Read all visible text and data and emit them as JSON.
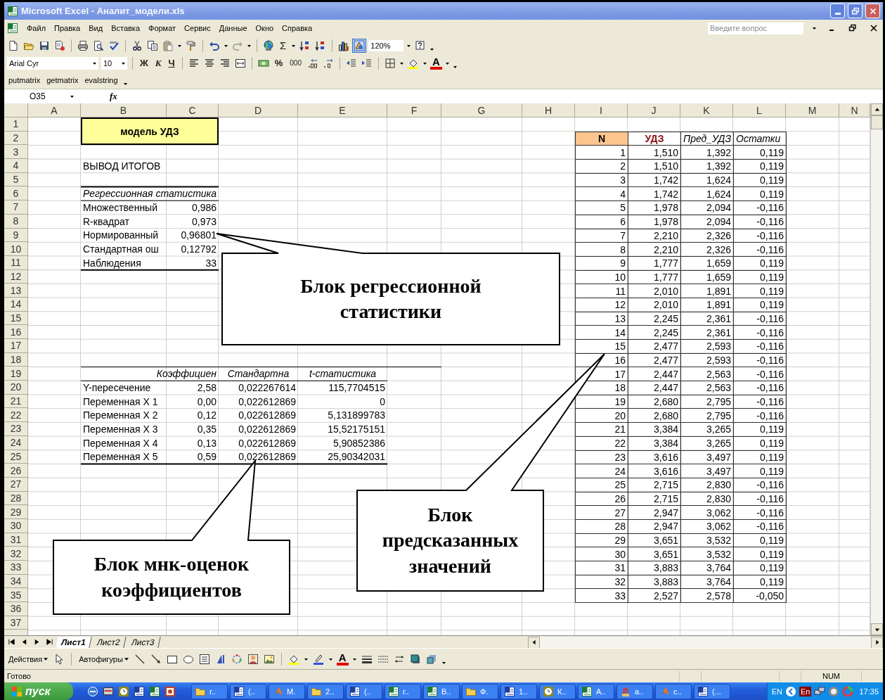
{
  "window": {
    "title": "Microsoft Excel - Аналит_модели.xls"
  },
  "menu": {
    "items": [
      "Файл",
      "Правка",
      "Вид",
      "Вставка",
      "Формат",
      "Сервис",
      "Данные",
      "Окно",
      "Справка"
    ],
    "help_placeholder": "Введите вопрос"
  },
  "standard_toolbar": {
    "sum_label": "Σ",
    "zoom": "120%"
  },
  "formatting_toolbar": {
    "font": "Arial Cyr",
    "size": "10",
    "bold_label": "Ж",
    "italic_label": "К",
    "underline_label": "Ч",
    "percent_label": "%",
    "thousands_label": "000",
    "font_color_label": "A"
  },
  "custom_toolbar": {
    "buttons": [
      "putmatrix",
      "getmatrix",
      "evalstring"
    ]
  },
  "formula_bar": {
    "name_box": "O35",
    "fx_label": "fx"
  },
  "sheet": {
    "columns": [
      "A",
      "B",
      "C",
      "D",
      "E",
      "F",
      "G",
      "H",
      "I",
      "J",
      "K",
      "L",
      "M",
      "N"
    ],
    "rows": [
      "1",
      "2",
      "3",
      "4",
      "5",
      "6",
      "7",
      "8",
      "9",
      "10",
      "11",
      "12",
      "13",
      "14",
      "15",
      "16",
      "17",
      "18",
      "19",
      "20",
      "21",
      "22",
      "23",
      "24",
      "25",
      "26",
      "27",
      "28",
      "29",
      "30",
      "31",
      "32",
      "33",
      "34",
      "35",
      "36",
      "37"
    ],
    "title_cell": "модель УДЗ",
    "summary_label": "ВЫВОД ИТОГОВ",
    "regression_stats": {
      "title": "Регрессионная статистика",
      "rows": [
        {
          "label": "Множественный",
          "value": "0,986"
        },
        {
          "label": "R-квадрат",
          "value": "0,973"
        },
        {
          "label": "Нормированный",
          "value": "0,96801"
        },
        {
          "label": "Стандартная ош",
          "value": "0,12792"
        },
        {
          "label": "Наблюдения",
          "value": "33"
        }
      ]
    },
    "coefficients": {
      "headers": [
        "Коэффициен",
        "Стандартна",
        "t-статистика"
      ],
      "rows": [
        {
          "label": "Y-пересечение",
          "values": [
            "2,58",
            "0,022267614",
            "115,7704515"
          ]
        },
        {
          "label": "Переменная X 1",
          "values": [
            "0,00",
            "0,022612869",
            "0"
          ]
        },
        {
          "label": "Переменная X 2",
          "values": [
            "0,12",
            "0,022612869",
            "5,131899783"
          ]
        },
        {
          "label": "Переменная X 3",
          "values": [
            "0,35",
            "0,022612869",
            "15,52175151"
          ]
        },
        {
          "label": "Переменная X 4",
          "values": [
            "0,13",
            "0,022612869",
            "5,90852386"
          ]
        },
        {
          "label": "Переменная X 5",
          "values": [
            "0,59",
            "0,022612869",
            "25,90342031"
          ]
        }
      ]
    },
    "predictions": {
      "headers": [
        "N",
        "УДЗ",
        "Пред_УДЗ",
        "Остатки"
      ],
      "rows": [
        [
          "1",
          "1,510",
          "1,392",
          "0,119"
        ],
        [
          "2",
          "1,510",
          "1,392",
          "0,119"
        ],
        [
          "3",
          "1,742",
          "1,624",
          "0,119"
        ],
        [
          "4",
          "1,742",
          "1,624",
          "0,119"
        ],
        [
          "5",
          "1,978",
          "2,094",
          "-0,116"
        ],
        [
          "6",
          "1,978",
          "2,094",
          "-0,116"
        ],
        [
          "7",
          "2,210",
          "2,326",
          "-0,116"
        ],
        [
          "8",
          "2,210",
          "2,326",
          "-0,116"
        ],
        [
          "9",
          "1,777",
          "1,659",
          "0,119"
        ],
        [
          "10",
          "1,777",
          "1,659",
          "0,119"
        ],
        [
          "11",
          "2,010",
          "1,891",
          "0,119"
        ],
        [
          "12",
          "2,010",
          "1,891",
          "0,119"
        ],
        [
          "13",
          "2,245",
          "2,361",
          "-0,116"
        ],
        [
          "14",
          "2,245",
          "2,361",
          "-0,116"
        ],
        [
          "15",
          "2,477",
          "2,593",
          "-0,116"
        ],
        [
          "16",
          "2,477",
          "2,593",
          "-0,116"
        ],
        [
          "17",
          "2,447",
          "2,563",
          "-0,116"
        ],
        [
          "18",
          "2,447",
          "2,563",
          "-0,116"
        ],
        [
          "19",
          "2,680",
          "2,795",
          "-0,116"
        ],
        [
          "20",
          "2,680",
          "2,795",
          "-0,116"
        ],
        [
          "21",
          "3,384",
          "3,265",
          "0,119"
        ],
        [
          "22",
          "3,384",
          "3,265",
          "0,119"
        ],
        [
          "23",
          "3,616",
          "3,497",
          "0,119"
        ],
        [
          "24",
          "3,616",
          "3,497",
          "0,119"
        ],
        [
          "25",
          "2,715",
          "2,830",
          "-0,116"
        ],
        [
          "26",
          "2,715",
          "2,830",
          "-0,116"
        ],
        [
          "27",
          "2,947",
          "3,062",
          "-0,116"
        ],
        [
          "28",
          "2,947",
          "3,062",
          "-0,116"
        ],
        [
          "29",
          "3,651",
          "3,532",
          "0,119"
        ],
        [
          "30",
          "3,651",
          "3,532",
          "0,119"
        ],
        [
          "31",
          "3,883",
          "3,764",
          "0,119"
        ],
        [
          "32",
          "3,883",
          "3,764",
          "0,119"
        ],
        [
          "33",
          "2,527",
          "2,578",
          "-0,050"
        ]
      ]
    }
  },
  "callouts": [
    {
      "text": "Блок регрессионной статистики"
    },
    {
      "text": "Блок мнк-оценок коэффициентов"
    },
    {
      "text": "Блок предсказанных значений"
    }
  ],
  "sheet_tabs": [
    {
      "label": "Лист1",
      "selected": true
    },
    {
      "label": "Лист2",
      "selected": false
    },
    {
      "label": "Лист3",
      "selected": false
    }
  ],
  "drawing_toolbar": {
    "actions": "Действия",
    "autoshapes": "Автофигуры",
    "font_color_label": "A"
  },
  "status_bar": {
    "status": "Готово",
    "indicator": "NUM"
  },
  "taskbar": {
    "start": "пуск",
    "tasks": [
      {
        "kind": "folder",
        "label": "г.."
      },
      {
        "kind": "word",
        "label": "(.."
      },
      {
        "kind": "matlab",
        "label": "M."
      },
      {
        "kind": "folder",
        "label": "2.."
      },
      {
        "kind": "word",
        "label": "(.."
      },
      {
        "kind": "excel",
        "label": "г.."
      },
      {
        "kind": "excel",
        "label": "В.."
      },
      {
        "kind": "folder",
        "label": "Ф."
      },
      {
        "kind": "word",
        "label": "1.."
      },
      {
        "kind": "clock",
        "label": "К.."
      },
      {
        "kind": "excel",
        "label": "А.."
      },
      {
        "kind": "paint",
        "label": "а.."
      },
      {
        "kind": "matlab",
        "label": "с.."
      },
      {
        "kind": "word",
        "label": "(..."
      }
    ],
    "tray": {
      "language": "EN",
      "keyboard": "En",
      "clock": "17:35"
    }
  }
}
